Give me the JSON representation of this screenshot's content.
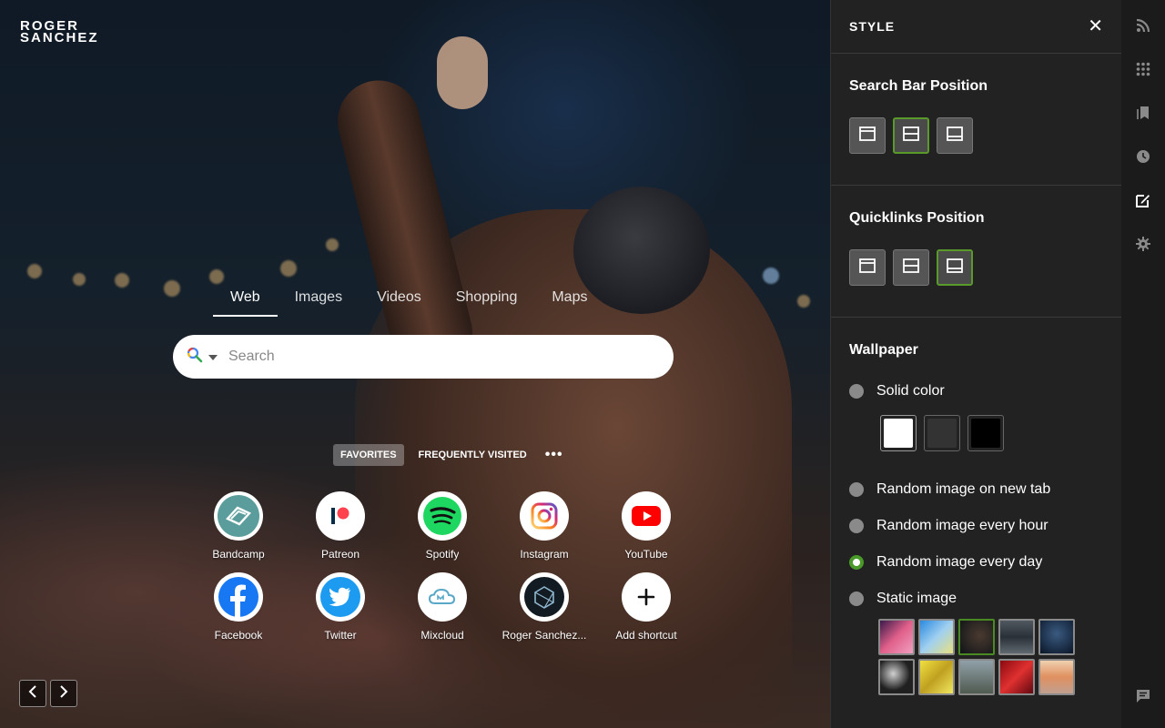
{
  "brand": {
    "line1": "ROGER",
    "line2": "SANCHEZ"
  },
  "search": {
    "tabs": [
      {
        "label": "Web",
        "active": true
      },
      {
        "label": "Images"
      },
      {
        "label": "Videos"
      },
      {
        "label": "Shopping"
      },
      {
        "label": "Maps"
      }
    ],
    "placeholder": "Search",
    "engine_icon": "search-engine-icon"
  },
  "quicklinks": {
    "tabs": [
      {
        "label": "FAVORITES",
        "active": true
      },
      {
        "label": "FREQUENTLY VISITED"
      }
    ],
    "more": "•••",
    "items": [
      {
        "label": "Bandcamp",
        "icon": "bandcamp-icon"
      },
      {
        "label": "Patreon",
        "icon": "patreon-icon"
      },
      {
        "label": "Spotify",
        "icon": "spotify-icon"
      },
      {
        "label": "Instagram",
        "icon": "instagram-icon"
      },
      {
        "label": "YouTube",
        "icon": "youtube-icon"
      },
      {
        "label": "Facebook",
        "icon": "facebook-icon"
      },
      {
        "label": "Twitter",
        "icon": "twitter-icon"
      },
      {
        "label": "Mixcloud",
        "icon": "mixcloud-icon"
      },
      {
        "label": "Roger Sanchez...",
        "icon": "roger-sanchez-icon"
      },
      {
        "label": "Add shortcut",
        "icon": "plus-icon"
      }
    ]
  },
  "panel": {
    "title": "STYLE",
    "close": "✕",
    "search_bar_position": {
      "title": "Search Bar Position",
      "selected": "middle"
    },
    "quicklinks_position": {
      "title": "Quicklinks Position",
      "selected": "bottom"
    },
    "wallpaper": {
      "title": "Wallpaper",
      "options": [
        {
          "label": "Solid color",
          "checked": false
        },
        {
          "label": "Random image on new tab",
          "checked": false
        },
        {
          "label": "Random image every hour",
          "checked": false
        },
        {
          "label": "Random image every day",
          "checked": true
        },
        {
          "label": "Static image",
          "checked": false
        }
      ],
      "solid_colors": [
        "#ffffff",
        "#333333",
        "#000000"
      ],
      "thumbnails_selected_index": 2
    }
  },
  "colors": {
    "accent_green": "#4a9a2a",
    "panel_bg": "#222222",
    "rail_bg": "#1b1b1b"
  },
  "rail": [
    "rss-icon",
    "apps-grid-icon",
    "bookmarks-icon",
    "history-icon",
    "style-edit-icon",
    "settings-gear-icon",
    "feedback-icon"
  ]
}
